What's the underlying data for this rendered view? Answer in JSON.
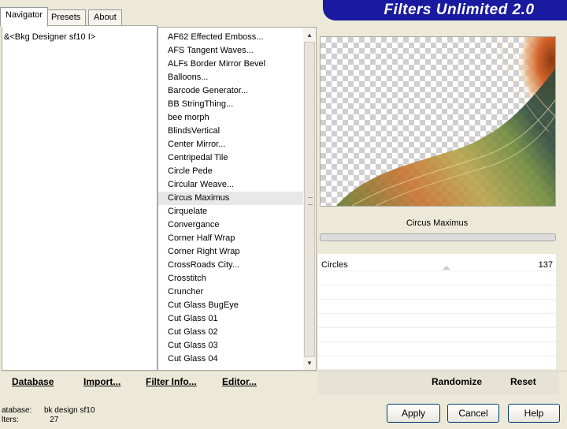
{
  "tabs": [
    "Navigator",
    "Presets",
    "About"
  ],
  "banner_title": "Filters Unlimited 2.0",
  "category": "&<Bkg Designer sf10 I>",
  "filters": [
    "AF62 Effected Emboss...",
    "AFS Tangent Waves...",
    "ALFs Border Mirror Bevel",
    "Balloons...",
    "Barcode Generator...",
    "BB StringThing...",
    "bee morph",
    "BlindsVertical",
    "Center Mirror...",
    "Centripedal Tile",
    "Circle Pede",
    "Circular Weave...",
    "Circus Maximus",
    "Cirquelate",
    "Convergance",
    "Corner Half Wrap",
    "Corner Right Wrap",
    "CrossRoads City...",
    "Crosstitch",
    "Cruncher",
    "Cut Glass  BugEye",
    "Cut Glass 01",
    "Cut Glass 02",
    "Cut Glass 03",
    "Cut Glass 04"
  ],
  "selected_filter": "Circus Maximus",
  "params": [
    {
      "label": "Circles",
      "value": "137",
      "level": 0.54
    }
  ],
  "toolbar": {
    "database": "Database",
    "import": "Import...",
    "filter_info": "Filter Info...",
    "editor": "Editor...",
    "randomize": "Randomize",
    "reset": "Reset"
  },
  "status": {
    "database_label": "atabase:",
    "database_value": "bk design sf10",
    "filters_label": "lters:",
    "filters_value": "27"
  },
  "buttons": {
    "apply": "Apply",
    "cancel": "Cancel",
    "help": "Help"
  },
  "colors": {
    "banner": "#1a1aa0",
    "selection": "#e8e8e8"
  }
}
